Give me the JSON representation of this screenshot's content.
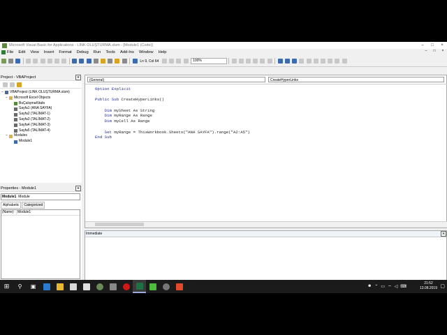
{
  "window": {
    "title": "Microsoft Visual Basic for Applications - LINK OLUŞTURMA.xlsm - [Module1 (Code)]",
    "controls": [
      "–",
      "□",
      "×"
    ],
    "inner_controls": [
      "–",
      "□",
      "×"
    ]
  },
  "menu": {
    "items": [
      "File",
      "Edit",
      "View",
      "Insert",
      "Format",
      "Debug",
      "Run",
      "Tools",
      "Add-Ins",
      "Window",
      "Help"
    ]
  },
  "toolbar": {
    "position_text": "Ln 9, Col 64",
    "zoom": "100%"
  },
  "project_pane": {
    "title": "Project - VBAProject",
    "close": "×",
    "tree": {
      "root": "VBAProject (LINK OLUŞTURMA.xlsm)",
      "folder1": "Microsoft Excel Objects",
      "items": [
        "BuÇalışmaKitabı",
        "Sayfa1 (ANA SAYFA)",
        "Sayfa2 (TALİMAT-1)",
        "Sayfa3 (TALİMAT-2)",
        "Sayfa4 (TALİMAT-3)",
        "Sayfa5 (TALİMAT-4)"
      ],
      "folder2": "Modules",
      "module": "Module1"
    }
  },
  "properties_pane": {
    "title": "Properties - Module1",
    "close": "×",
    "object_name": "Module1",
    "object_type": "Module",
    "tabs": [
      "Alphabetic",
      "Categorized"
    ],
    "row_name": "(Name)",
    "row_value": "Module1"
  },
  "code_window": {
    "object_dropdown": "(General)",
    "proc_dropdown": "CreateHyperLinks",
    "lines": [
      {
        "kw": "Option Explicit",
        "rest": ""
      },
      {
        "kw": "",
        "rest": ""
      },
      {
        "kw": "Public Sub",
        "rest": " CreateHyperLinks()"
      },
      {
        "kw": "",
        "rest": ""
      },
      {
        "kw": "    Dim",
        "rest": " mySheet As String"
      },
      {
        "kw": "    Dim",
        "rest": " myRange As Range"
      },
      {
        "kw": "    Dim",
        "rest": " myCell As Range"
      },
      {
        "kw": "",
        "rest": ""
      },
      {
        "kw": "    Set",
        "rest": " myRange = ThisWorkbook.Sheets(\"ANA SAYFA\").range(\"A2:A5\")"
      },
      {
        "kw": "End Sub",
        "rest": ""
      }
    ]
  },
  "immediate": {
    "title": "Immediate",
    "close": "×"
  },
  "taskbar": {
    "time": "21:52",
    "date": "13.08.2019"
  },
  "colors": {
    "keyword": "#1e2a8a",
    "taskbar": "#1b1b1b"
  }
}
